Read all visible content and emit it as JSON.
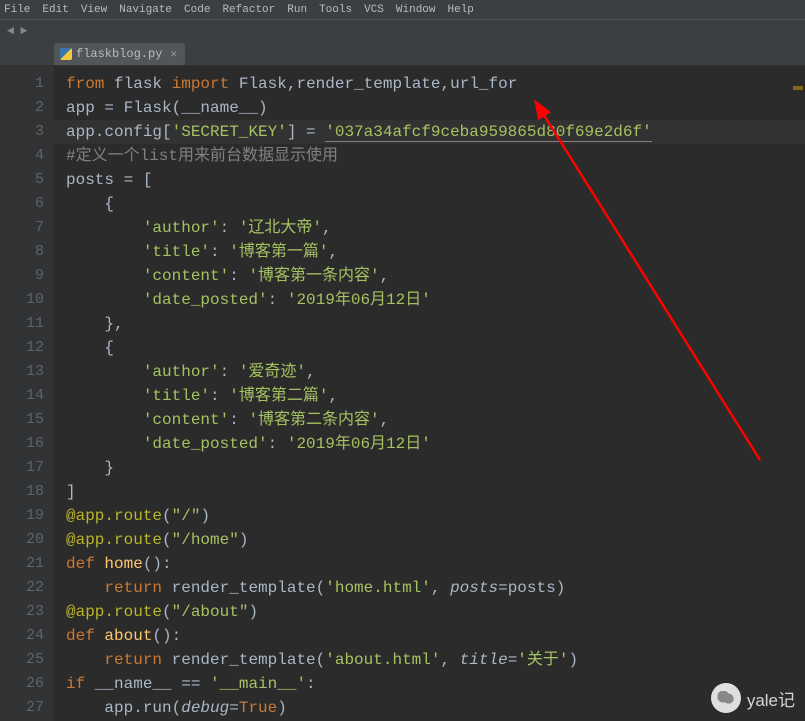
{
  "menubar": [
    "File",
    "Edit",
    "View",
    "Navigate",
    "Code",
    "Refactor",
    "Run",
    "Tools",
    "VCS",
    "Window",
    "Help"
  ],
  "tab": {
    "filename": "flaskblog.py"
  },
  "code": {
    "lines": [
      {
        "n": 1,
        "spans": [
          {
            "t": "from ",
            "c": "kw"
          },
          {
            "t": "flask ",
            "c": ""
          },
          {
            "t": "import ",
            "c": "kw"
          },
          {
            "t": "Flask",
            "c": ""
          },
          {
            "t": ",",
            "c": "op"
          },
          {
            "t": "render_template",
            "c": ""
          },
          {
            "t": ",",
            "c": "op"
          },
          {
            "t": "url_for",
            "c": ""
          }
        ]
      },
      {
        "n": 2,
        "spans": [
          {
            "t": "app = Flask(__name__)",
            "c": ""
          }
        ]
      },
      {
        "n": 3,
        "hl": true,
        "spans": [
          {
            "t": "app.config[",
            "c": ""
          },
          {
            "t": "'SECRET_KEY'",
            "c": "str"
          },
          {
            "t": "] = ",
            "c": ""
          },
          {
            "t": "'037a34afcf9ceba959865d80f69e2d6f'",
            "c": "strhl"
          }
        ]
      },
      {
        "n": 4,
        "spans": [
          {
            "t": "#定义一个list用来前台数据显示使用",
            "c": "cmt"
          }
        ]
      },
      {
        "n": 5,
        "spans": [
          {
            "t": "posts = [",
            "c": ""
          }
        ]
      },
      {
        "n": 6,
        "spans": [
          {
            "t": "    {",
            "c": ""
          }
        ]
      },
      {
        "n": 7,
        "spans": [
          {
            "t": "        ",
            "c": ""
          },
          {
            "t": "'author'",
            "c": "str"
          },
          {
            "t": ": ",
            "c": ""
          },
          {
            "t": "'辽北大帝'",
            "c": "str"
          },
          {
            "t": ",",
            "c": "op"
          }
        ]
      },
      {
        "n": 8,
        "spans": [
          {
            "t": "        ",
            "c": ""
          },
          {
            "t": "'title'",
            "c": "str"
          },
          {
            "t": ": ",
            "c": ""
          },
          {
            "t": "'博客第一篇'",
            "c": "str"
          },
          {
            "t": ",",
            "c": "op"
          }
        ]
      },
      {
        "n": 9,
        "spans": [
          {
            "t": "        ",
            "c": ""
          },
          {
            "t": "'content'",
            "c": "str"
          },
          {
            "t": ": ",
            "c": ""
          },
          {
            "t": "'博客第一条内容'",
            "c": "str"
          },
          {
            "t": ",",
            "c": "op"
          }
        ]
      },
      {
        "n": 10,
        "spans": [
          {
            "t": "        ",
            "c": ""
          },
          {
            "t": "'date_posted'",
            "c": "str"
          },
          {
            "t": ": ",
            "c": ""
          },
          {
            "t": "'2019年06月12日'",
            "c": "str"
          }
        ]
      },
      {
        "n": 11,
        "spans": [
          {
            "t": "    }",
            "c": ""
          },
          {
            "t": ",",
            "c": "op"
          }
        ]
      },
      {
        "n": 12,
        "spans": [
          {
            "t": "    {",
            "c": ""
          }
        ]
      },
      {
        "n": 13,
        "spans": [
          {
            "t": "        ",
            "c": ""
          },
          {
            "t": "'author'",
            "c": "str"
          },
          {
            "t": ": ",
            "c": ""
          },
          {
            "t": "'爱奇迹'",
            "c": "str"
          },
          {
            "t": ",",
            "c": "op"
          }
        ]
      },
      {
        "n": 14,
        "spans": [
          {
            "t": "        ",
            "c": ""
          },
          {
            "t": "'title'",
            "c": "str"
          },
          {
            "t": ": ",
            "c": ""
          },
          {
            "t": "'博客第二篇'",
            "c": "str"
          },
          {
            "t": ",",
            "c": "op"
          }
        ]
      },
      {
        "n": 15,
        "spans": [
          {
            "t": "        ",
            "c": ""
          },
          {
            "t": "'content'",
            "c": "str"
          },
          {
            "t": ": ",
            "c": ""
          },
          {
            "t": "'博客第二条内容'",
            "c": "str"
          },
          {
            "t": ",",
            "c": "op"
          }
        ]
      },
      {
        "n": 16,
        "spans": [
          {
            "t": "        ",
            "c": ""
          },
          {
            "t": "'date_posted'",
            "c": "str"
          },
          {
            "t": ": ",
            "c": ""
          },
          {
            "t": "'2019年06月12日'",
            "c": "str"
          }
        ]
      },
      {
        "n": 17,
        "spans": [
          {
            "t": "    }",
            "c": ""
          }
        ]
      },
      {
        "n": 18,
        "spans": [
          {
            "t": "]",
            "c": ""
          }
        ]
      },
      {
        "n": 19,
        "spans": [
          {
            "t": "@app.route",
            "c": "dec"
          },
          {
            "t": "(",
            "c": ""
          },
          {
            "t": "\"/\"",
            "c": "str"
          },
          {
            "t": ")",
            "c": ""
          }
        ]
      },
      {
        "n": 20,
        "spans": [
          {
            "t": "@app.route",
            "c": "dec"
          },
          {
            "t": "(",
            "c": ""
          },
          {
            "t": "\"/home\"",
            "c": "str"
          },
          {
            "t": ")",
            "c": ""
          }
        ]
      },
      {
        "n": 21,
        "spans": [
          {
            "t": "def ",
            "c": "kw"
          },
          {
            "t": "home",
            "c": "fn"
          },
          {
            "t": "():",
            "c": ""
          }
        ]
      },
      {
        "n": 22,
        "spans": [
          {
            "t": "    ",
            "c": ""
          },
          {
            "t": "return ",
            "c": "kw"
          },
          {
            "t": "render_template(",
            "c": ""
          },
          {
            "t": "'home.html'",
            "c": "str"
          },
          {
            "t": ", ",
            "c": ""
          },
          {
            "t": "posts",
            "c": "arg"
          },
          {
            "t": "=posts)",
            "c": ""
          }
        ]
      },
      {
        "n": 23,
        "spans": [
          {
            "t": "@app.route",
            "c": "dec"
          },
          {
            "t": "(",
            "c": ""
          },
          {
            "t": "\"/about\"",
            "c": "str"
          },
          {
            "t": ")",
            "c": ""
          }
        ]
      },
      {
        "n": 24,
        "spans": [
          {
            "t": "def ",
            "c": "kw"
          },
          {
            "t": "about",
            "c": "fn"
          },
          {
            "t": "():",
            "c": ""
          }
        ]
      },
      {
        "n": 25,
        "spans": [
          {
            "t": "    ",
            "c": ""
          },
          {
            "t": "return ",
            "c": "kw"
          },
          {
            "t": "render_template(",
            "c": ""
          },
          {
            "t": "'about.html'",
            "c": "str"
          },
          {
            "t": ", ",
            "c": ""
          },
          {
            "t": "title",
            "c": "arg"
          },
          {
            "t": "=",
            "c": ""
          },
          {
            "t": "'关于'",
            "c": "str"
          },
          {
            "t": ")",
            "c": ""
          }
        ]
      },
      {
        "n": 26,
        "spans": [
          {
            "t": "if ",
            "c": "kw"
          },
          {
            "t": "__name__ == ",
            "c": ""
          },
          {
            "t": "'__main__'",
            "c": "str"
          },
          {
            "t": ":",
            "c": ""
          }
        ]
      },
      {
        "n": 27,
        "spans": [
          {
            "t": "    app.run(",
            "c": ""
          },
          {
            "t": "debug",
            "c": "arg"
          },
          {
            "t": "=",
            "c": ""
          },
          {
            "t": "True",
            "c": "kw"
          },
          {
            "t": ")",
            "c": ""
          }
        ]
      }
    ]
  },
  "watermark": "yale记"
}
